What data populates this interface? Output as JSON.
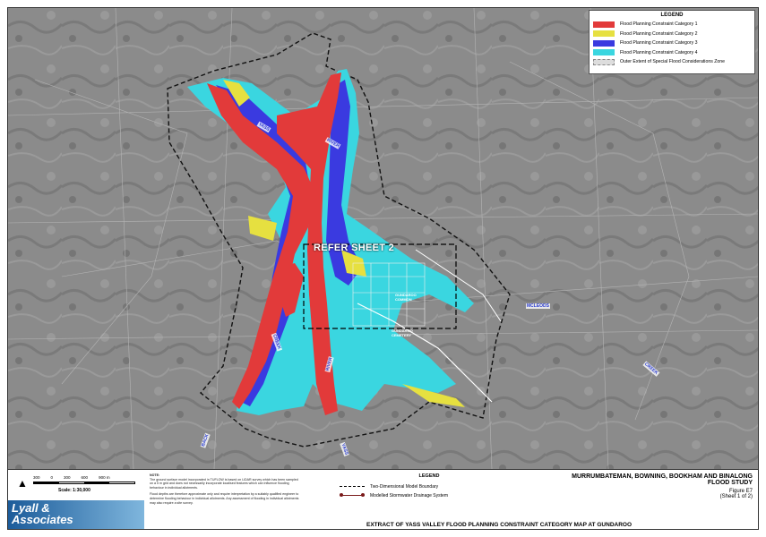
{
  "legend": {
    "title": "LEGEND",
    "items": [
      {
        "label": "Flood Planning Constraint Category 1",
        "color": "#e23a3a"
      },
      {
        "label": "Flood Planning Constraint Category 2",
        "color": "#e6e040"
      },
      {
        "label": "Flood Planning Constraint Category 3",
        "color": "#3a3ae0"
      },
      {
        "label": "Flood Planning Constraint Category 4",
        "color": "#3ad6e0"
      },
      {
        "label": "Outer Extent of Special Flood Considerations Zone",
        "color": "#dddddd"
      }
    ]
  },
  "map": {
    "sheet_ref": "REFER SHEET 2",
    "rivers": [
      "YASS",
      "RIVER",
      "RIVER",
      "YASS",
      "CREEK",
      "MCLEODS",
      "BACK",
      "CREEK"
    ],
    "places": [
      "GUNDAROO COMMON",
      "GUNDAROO CEMETERY"
    ]
  },
  "footer": {
    "scale": {
      "ticks": [
        "300",
        "0",
        "300",
        "600",
        "900 m"
      ],
      "label": "Scale: 1:30,000"
    },
    "logo": [
      "Lyall &",
      "Associates"
    ],
    "notes": {
      "heading": "NOTE:",
      "p1": "The ground surface model incorporated in TUFLOW is based on LiDAR survey which has been sampled on a 5 m grid and does not necessarily incorporate localised features which can influence flooding behaviour in individual allotments.",
      "p2": "Flood depths are therefore approximate only and require interpretation by a suitably qualified engineer to determine flooding behaviour in individual allotments. Any assessment of flooding in individual allotments may also require a site survey."
    },
    "legend": {
      "title": "LEGEND",
      "items": [
        "Two-Dimensional Model Boundary",
        "Modelled Stormwater Drainage System"
      ]
    },
    "title": {
      "line1": "MURRUMBATEMAN, BOWNING, BOOKHAM AND BINALONG",
      "line2": "FLOOD STUDY",
      "figure": "Figure E7",
      "sheet": "(Sheet 1 of 2)"
    },
    "caption": "EXTRACT OF YASS VALLEY FLOOD PLANNING CONSTRAINT CATEGORY MAP AT GUNDAROO"
  }
}
